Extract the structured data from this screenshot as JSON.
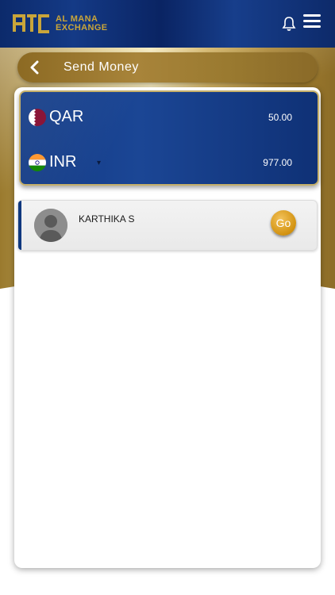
{
  "header": {
    "logo_line1": "AL MANA",
    "logo_line2": "EXCHANGE"
  },
  "titlebar": {
    "title": "Send Money"
  },
  "exchange": {
    "from": {
      "currency": "QAR",
      "amount": "50.00"
    },
    "to": {
      "currency": "INR",
      "amount": "977.00"
    }
  },
  "recipient": {
    "name": "KARTHIKA S",
    "go_label": "Go"
  },
  "colors": {
    "header_blue": "#0c2a6b",
    "gold": "#c9a53a",
    "card_blue": "#123a85",
    "go_gold": "#d29210"
  }
}
